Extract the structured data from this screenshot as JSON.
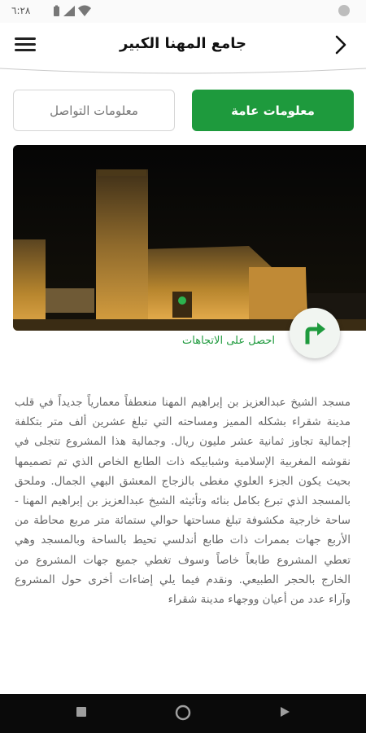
{
  "status_bar": {
    "time": "٦:٢٨"
  },
  "header": {
    "title": "جامع المهنا الكبير"
  },
  "tabs": [
    {
      "label": "معلومات عامة",
      "active": true
    },
    {
      "label": "معلومات التواصل",
      "active": false
    }
  ],
  "directions": {
    "label": "احصل على الاتجاهات",
    "icon": "turn-right-arrow-icon"
  },
  "description": "مسجد الشيخ عبدالعزيز بن إبراهيم المهنا منعطفاً معمارياً جديداً في قلب مدينة شقراء بشكله المميز ومساحته التي تبلغ عشرين ألف متر بتكلفة إجمالية تجاوز ثمانية عشر مليون ريال. وجمالية هذا المشروع تتجلى في نقوشه المغربية الإسلامية وشبابيكه ذات الطابع الخاص الذي تم تصميمها بحيث يكون الجزء العلوي مغطى بالزجاج المعشق البهي الجمال. وملحق بالمسجد الذي تبرع بكامل بنائه وتأثيثه الشيخ عبدالعزيز بن إبراهيم المهنا - ساحة خارجية مكشوفة تبلغ مساحتها حوالي ستمائة متر مربع محاطة من الأربع جهات بممرات ذات طابع أندلسي تحيط بالساحة وبالمسجد وهي تعطي المشروع طابعاً خاصاً وسوف تغطي جميع جهات المشروع من الخارج بالحجر الطبيعي. ونقدم فيما يلي إضاءات أخرى حول المشروع وآراء عدد من أعيان ووجهاء مدينة شقراء",
  "colors": {
    "accent": "#1e9a3d",
    "nav_bar": "#0a0a0a"
  }
}
